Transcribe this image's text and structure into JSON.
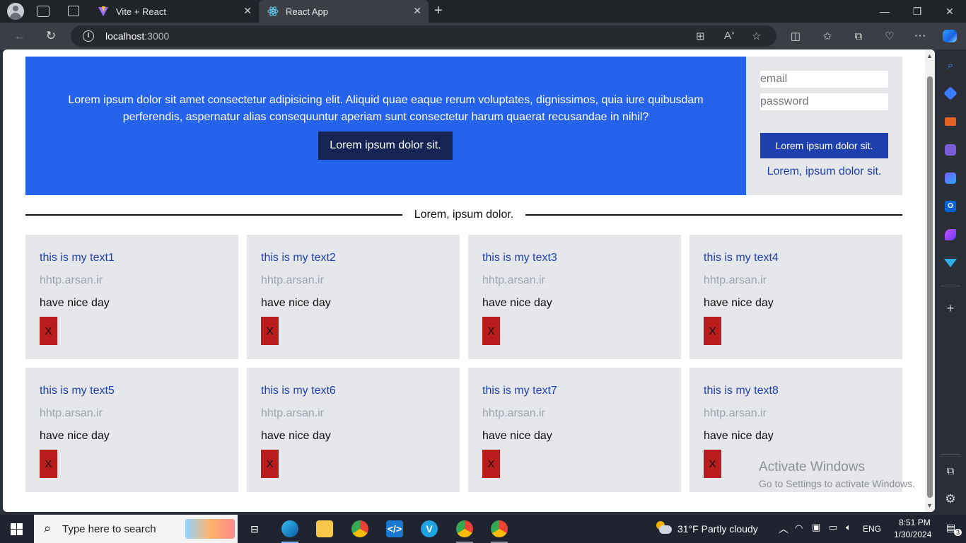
{
  "browser": {
    "tabs": [
      {
        "title": "Vite + React"
      },
      {
        "title": "React App"
      }
    ],
    "url_host": "localhost",
    "url_port": ":3000"
  },
  "hero": {
    "text": "Lorem ipsum dolor sit amet consectetur adipisicing elit. Aliquid quae eaque rerum voluptates, dignissimos, quia iure quibusdam perferendis, aspernatur alias consequuntur aperiam sunt consectetur harum quaerat recusandae in nihil?",
    "button_label": "Lorem ipsum dolor sit."
  },
  "login": {
    "email_placeholder": "email",
    "password_placeholder": "password",
    "button_label": "Lorem ipsum dolor sit.",
    "link_label": "Lorem, ipsum dolor sit."
  },
  "divider_label": "Lorem, ipsum dolor.",
  "cards": [
    {
      "title": "this is my text1",
      "url": "hhtp.arsan.ir",
      "desc": "have nice day",
      "delete": "X"
    },
    {
      "title": "this is my text2",
      "url": "hhtp.arsan.ir",
      "desc": "have nice day",
      "delete": "X"
    },
    {
      "title": "this is my text3",
      "url": "hhtp.arsan.ir",
      "desc": "have nice day",
      "delete": "X"
    },
    {
      "title": "this is my text4",
      "url": "hhtp.arsan.ir",
      "desc": "have nice day",
      "delete": "X"
    },
    {
      "title": "this is my text5",
      "url": "hhtp.arsan.ir",
      "desc": "have nice day",
      "delete": "X"
    },
    {
      "title": "this is my text6",
      "url": "hhtp.arsan.ir",
      "desc": "have nice day",
      "delete": "X"
    },
    {
      "title": "this is my text7",
      "url": "hhtp.arsan.ir",
      "desc": "have nice day",
      "delete": "X"
    },
    {
      "title": "this is my text8",
      "url": "hhtp.arsan.ir",
      "desc": "have nice day",
      "delete": "X"
    }
  ],
  "watermark": {
    "title": "Activate Windows",
    "subtitle": "Go to Settings to activate Windows."
  },
  "taskbar": {
    "search_placeholder": "Type here to search",
    "weather": "31°F  Partly cloudy",
    "language": "ENG",
    "time": "8:51 PM",
    "date": "1/30/2024",
    "notifications": "3"
  }
}
